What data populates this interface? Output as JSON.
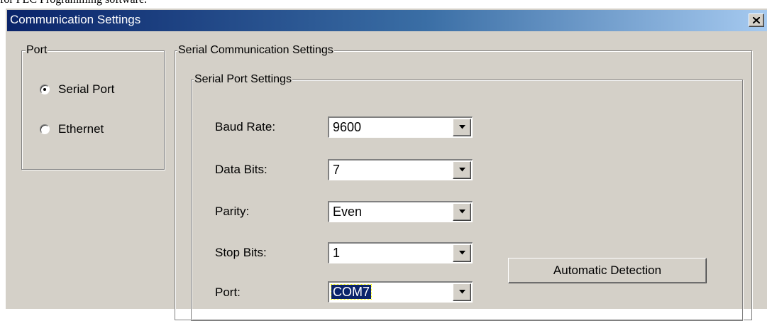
{
  "page_caption": "for PLC Programming software.",
  "dialog": {
    "title": "Communication Settings",
    "close_icon": "close-x-icon"
  },
  "port_group": {
    "label": "Port",
    "options": [
      {
        "label": "Serial Port",
        "selected": true
      },
      {
        "label": "Ethernet",
        "selected": false
      }
    ]
  },
  "serial_comm": {
    "label": "Serial Communication Settings",
    "serial_port_settings": {
      "label": "Serial Port Settings",
      "fields": [
        {
          "label": "Baud Rate:",
          "value": "9600",
          "dropdown_icon": "chevron-down-icon"
        },
        {
          "label": "Data Bits:",
          "value": "7",
          "dropdown_icon": "chevron-down-icon"
        },
        {
          "label": "Parity:",
          "value": "Even",
          "dropdown_icon": "chevron-down-icon"
        },
        {
          "label": "Stop Bits:",
          "value": "1",
          "dropdown_icon": "chevron-down-icon"
        },
        {
          "label": "Port:",
          "value": "COM7",
          "dropdown_icon": "chevron-down-icon",
          "focused": true
        }
      ]
    },
    "auto_detect_button": "Automatic Detection"
  }
}
